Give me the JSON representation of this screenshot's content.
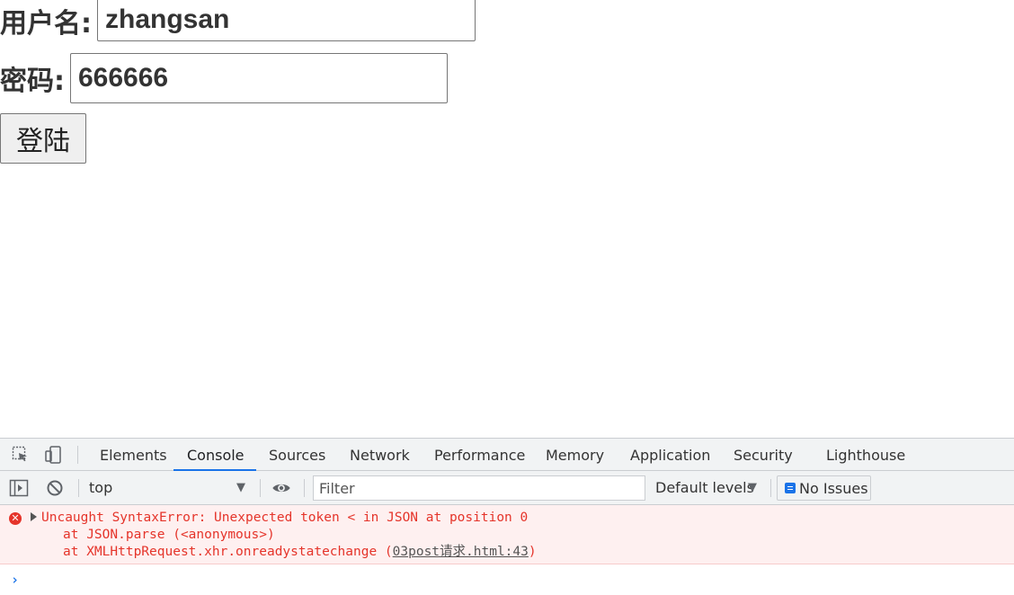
{
  "form": {
    "username_label": "用户名:",
    "username_value": "zhangsan",
    "password_label": "密码:",
    "password_value": "666666",
    "login_button": "登陆"
  },
  "devtools": {
    "tabs": [
      "Elements",
      "Console",
      "Sources",
      "Network",
      "Performance",
      "Memory",
      "Application",
      "Security",
      "Lighthouse"
    ],
    "active_tab": "Console",
    "toolbar": {
      "context": "top",
      "filter_placeholder": "Filter",
      "levels": "Default levels",
      "issues": "No Issues"
    },
    "console": {
      "error_message": "Uncaught SyntaxError: Unexpected token < in JSON at position 0",
      "stack_line_1": "at JSON.parse (<anonymous>)",
      "stack_line_2_prefix": "at XMLHttpRequest.xhr.onreadystatechange (",
      "stack_line_2_link": "03post请求.html:43",
      "stack_line_2_suffix": ")"
    },
    "colors": {
      "accent": "#1a73e8",
      "error_text": "#e5342a",
      "error_bg": "#fef0f0",
      "panel_bg": "#f1f3f4"
    }
  }
}
